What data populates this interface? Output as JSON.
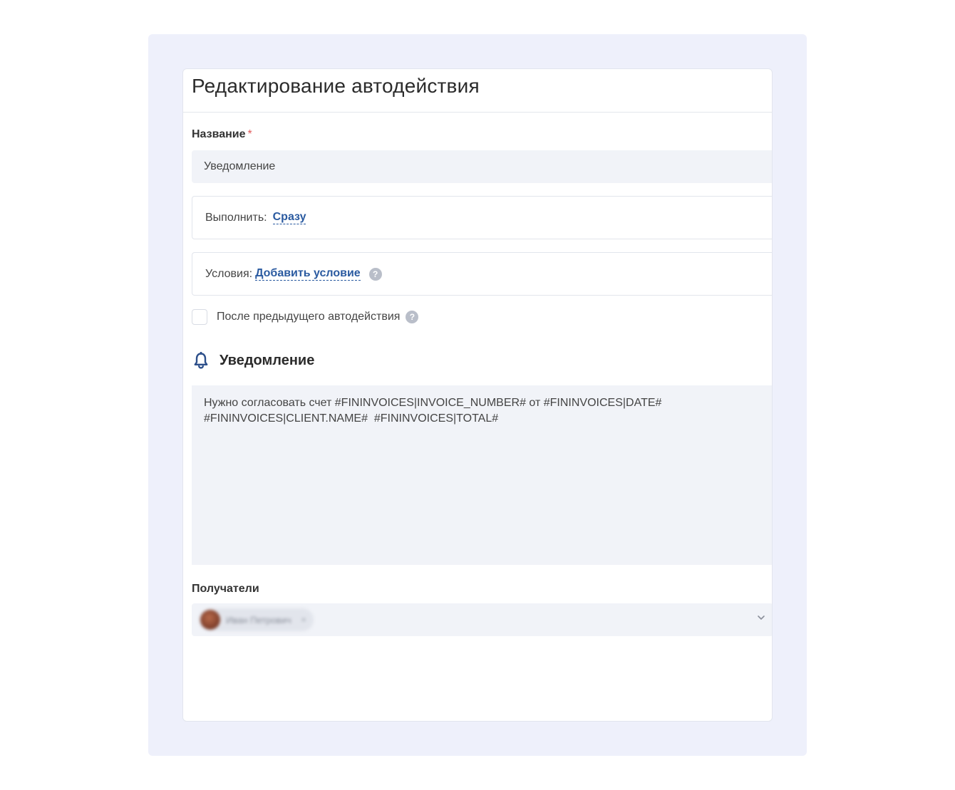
{
  "form": {
    "title": "Редактирование автодействия",
    "name_label": "Название",
    "required_mark": "*",
    "name_value": "Уведомление",
    "execute": {
      "label": "Выполнить:",
      "link": "Сразу"
    },
    "conditions": {
      "label": "Условия:",
      "link": "Добавить условие",
      "help_icon": "question-circle-icon"
    },
    "after_previous": {
      "label": "После предыдущего автодействия",
      "checked": false,
      "help_icon": "question-circle-icon"
    },
    "notification": {
      "icon": "bell-icon",
      "title": "Уведомление",
      "message": "Нужно согласовать счет #FININVOICES|INVOICE_NUMBER# от #FININVOICES|DATE#\n#FININVOICES|CLIENT.NAME#  #FININVOICES|TOTAL#"
    },
    "recipients": {
      "label": "Получатели",
      "chips": [
        {
          "name": "Иван Петрович",
          "remove": "×"
        }
      ],
      "chevron_icon": "chevron-down-icon"
    }
  },
  "colors": {
    "frame_background": "#eef0fb",
    "input_background": "#f1f3f8",
    "link": "#2a5aa0",
    "required": "#e05a5a",
    "icon_blue": "#2d4f8a"
  }
}
